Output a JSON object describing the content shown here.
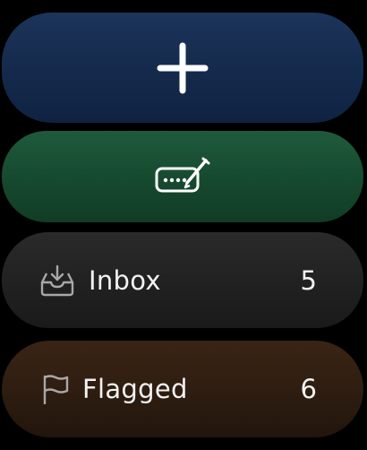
{
  "actions": {
    "new_icon": "plus-icon",
    "compose_icon": "scribble-keyboard-icon"
  },
  "mailboxes": [
    {
      "label": "Inbox",
      "count": "5",
      "icon": "inbox-tray-icon"
    },
    {
      "label": "Flagged",
      "count": "6",
      "icon": "flag-icon"
    }
  ],
  "colors": {
    "new_tile": "#142a4c",
    "compose_tile": "#16492f",
    "inbox_tile": "#202020",
    "flagged_tile": "#2c1c10",
    "icon": "#ffffff",
    "secondary_icon": "#a8a8a8"
  }
}
